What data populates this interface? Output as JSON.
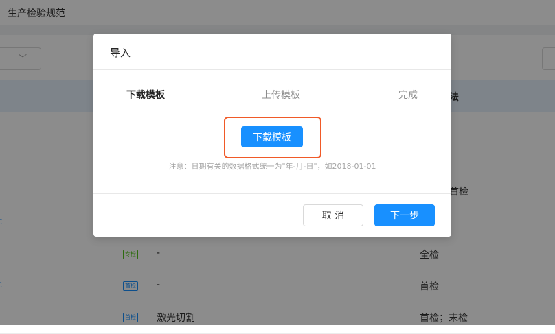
{
  "page": {
    "title": "生产检验规范",
    "table_header_method": "法",
    "rows": [
      {
        "left": "",
        "tag": "",
        "name": "",
        "method": ""
      },
      {
        "left": "",
        "tag": "",
        "name": "",
        "method": ""
      },
      {
        "left": "",
        "tag": "",
        "name": "",
        "method": "首检"
      },
      {
        "left": "c",
        "tag": "",
        "name": "",
        "method": ""
      },
      {
        "left": "",
        "tag": "专检",
        "name": "-",
        "method": "全检"
      },
      {
        "left": "c",
        "tag": "首检",
        "name": "-",
        "method": "首检"
      },
      {
        "left": "",
        "tag": "首检",
        "name": "激光切割",
        "method": "首检；末检"
      }
    ],
    "filter_chevron": "chevron-down-icon"
  },
  "modal": {
    "title": "导入",
    "steps": [
      "下载模板",
      "上传模板",
      "完成"
    ],
    "active_step": 0,
    "download_button": "下载模板",
    "note": "注意：日期有关的数据格式统一为\"年-月-日\"，如2018-01-01",
    "cancel_button": "取 消",
    "next_button": "下一步"
  },
  "colors": {
    "primary": "#1890ff",
    "highlight": "#f05a28",
    "table_header_bg": "#e6f0fb"
  }
}
